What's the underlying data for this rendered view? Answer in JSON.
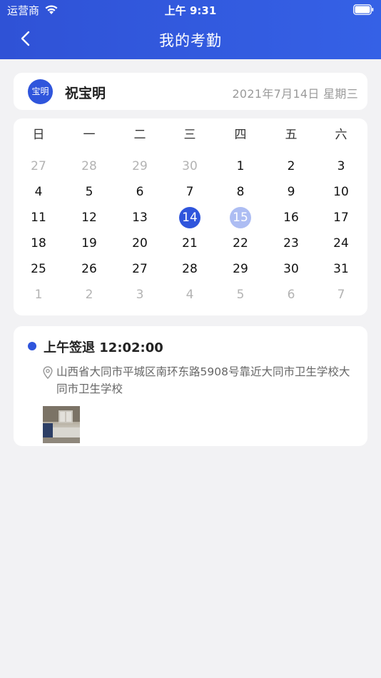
{
  "status_bar": {
    "carrier": "运营商",
    "time": "上午 9:31"
  },
  "nav": {
    "title": "我的考勤"
  },
  "profile": {
    "avatar_text": "宝明",
    "name": "祝宝明",
    "date": "2021年7月14日 星期三"
  },
  "calendar": {
    "weekdays": [
      "日",
      "一",
      "二",
      "三",
      "四",
      "五",
      "六"
    ],
    "rows": [
      [
        "27",
        "28",
        "29",
        "30",
        "1",
        "2",
        "3"
      ],
      [
        "4",
        "5",
        "6",
        "7",
        "8",
        "9",
        "10"
      ],
      [
        "11",
        "12",
        "13",
        "14",
        "15",
        "16",
        "17"
      ],
      [
        "18",
        "19",
        "20",
        "21",
        "22",
        "23",
        "24"
      ],
      [
        "25",
        "26",
        "27",
        "28",
        "29",
        "30",
        "31"
      ],
      [
        "1",
        "2",
        "3",
        "4",
        "5",
        "6",
        "7"
      ]
    ],
    "selected_day": "14",
    "highlighted_day": "15",
    "accent_color": "#2f55dc",
    "highlight_color": "#adbdf3"
  },
  "record": {
    "title": "上午签退 12:02:00",
    "address": "山西省大同市平城区南环东路5908号靠近大同市卫生学校大同市卫生学校"
  },
  "colors": {
    "header": "#3159e0",
    "background": "#f2f2f4",
    "accent": "#2f55dc"
  }
}
